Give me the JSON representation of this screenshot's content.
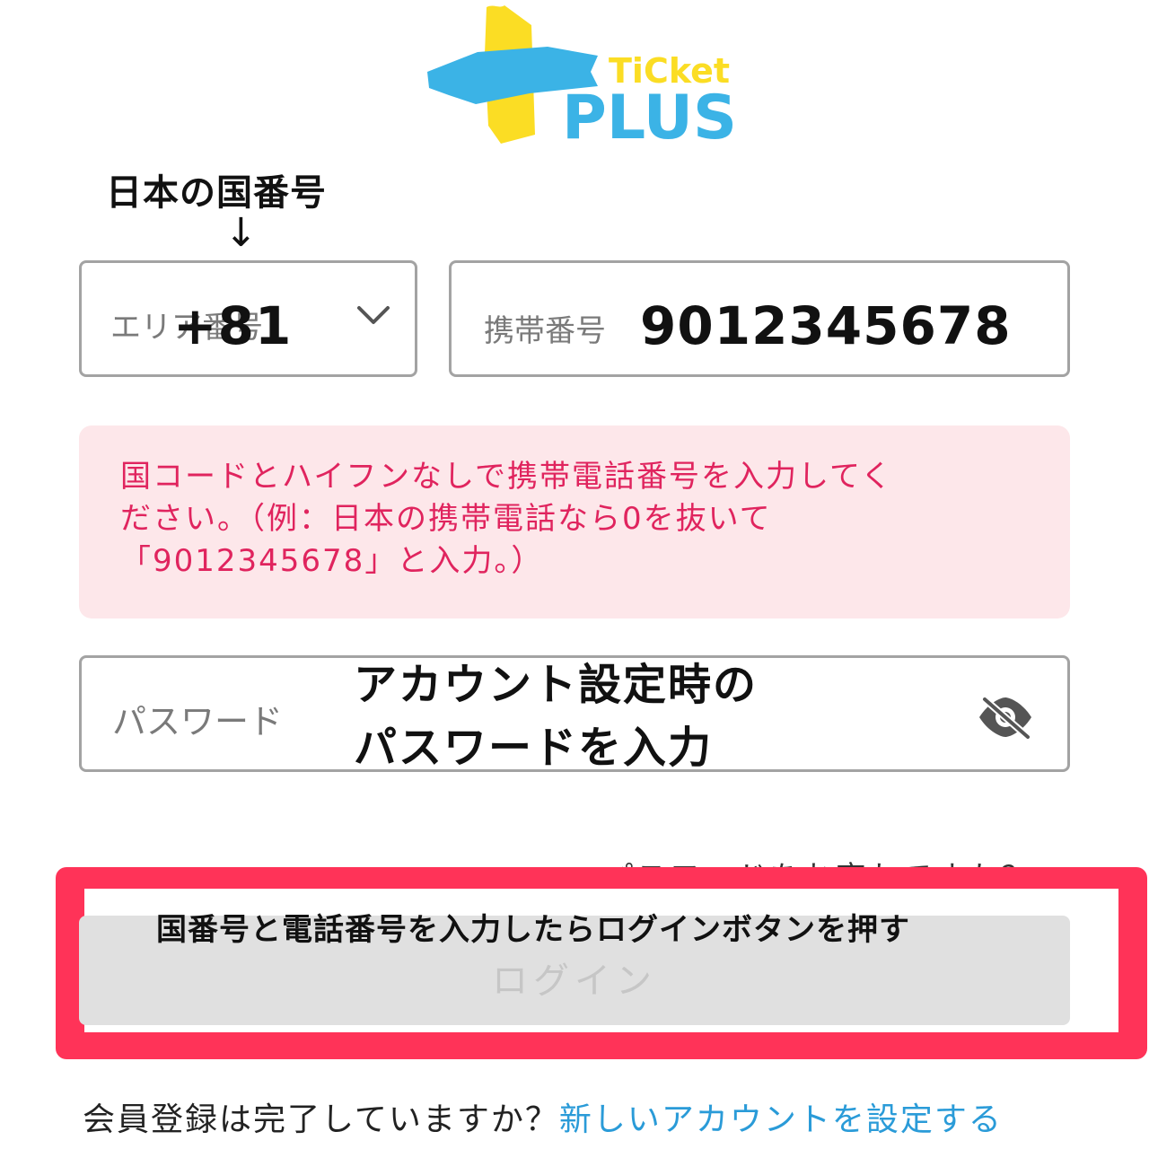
{
  "logo": {
    "top_text": "TiCket",
    "bottom_text": "PLUS",
    "colors": {
      "yellow": "#FBDD24",
      "blue": "#3BB3E6"
    }
  },
  "annotations": {
    "country_code": "日本の国番号",
    "arrow": "↓",
    "password_line1": "アカウント設定時の",
    "password_line2": "パスワードを入力",
    "login": "国番号と電話番号を入力したらログインボタンを押す"
  },
  "form": {
    "area_code": {
      "placeholder": "エリア番号",
      "value": "+81",
      "icon": "chevron-down-icon"
    },
    "phone": {
      "placeholder": "携帯番号",
      "value": "9012345678"
    },
    "error_message": {
      "line1": "国コードとハイフンなしで携帯電話番号を入力してく",
      "line2": "ださい。（例：日本の携帯電話なら0を抜いて",
      "line3": "「9012345678」と入力。）",
      "color": "#E0245E",
      "background": "#FDE7EA"
    },
    "password": {
      "placeholder": "パスワード",
      "icon": "eye-off-icon"
    },
    "forgot_password": "パスワードをお忘れですか？",
    "login_button": "ログイン"
  },
  "footer": {
    "question": "会員登録は完了していますか？",
    "link": "新しいアカウントを設定する",
    "link_color": "#2A9BD8"
  },
  "highlight_color": "#FF3358"
}
